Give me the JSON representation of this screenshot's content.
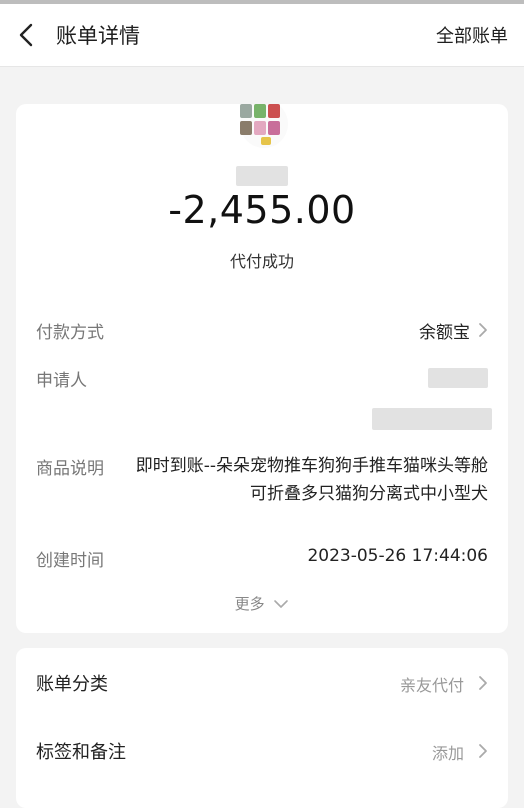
{
  "header": {
    "title": "账单详情",
    "right_link": "全部账单"
  },
  "summary": {
    "amount": "-2,455.00",
    "status": "代付成功"
  },
  "details": {
    "payment_method_label": "付款方式",
    "payment_method_value": "余额宝",
    "applicant_label": "申请人",
    "product_desc_label": "商品说明",
    "product_desc_value": "即时到账--朵朵宠物推车狗狗手推车猫咪头等舱可折叠多只猫狗分离式中小型犬",
    "created_label": "创建时间",
    "created_value": "2023-05-26 17:44:06",
    "more_label": "更多"
  },
  "bill": {
    "category_label": "账单分类",
    "category_value": "亲友代付",
    "tags_label": "标签和备注",
    "tags_value": "添加"
  },
  "colors": {
    "background": "#f3f3f3",
    "card": "#ffffff",
    "muted": "#777777",
    "redacted": "#e2e2e2"
  }
}
